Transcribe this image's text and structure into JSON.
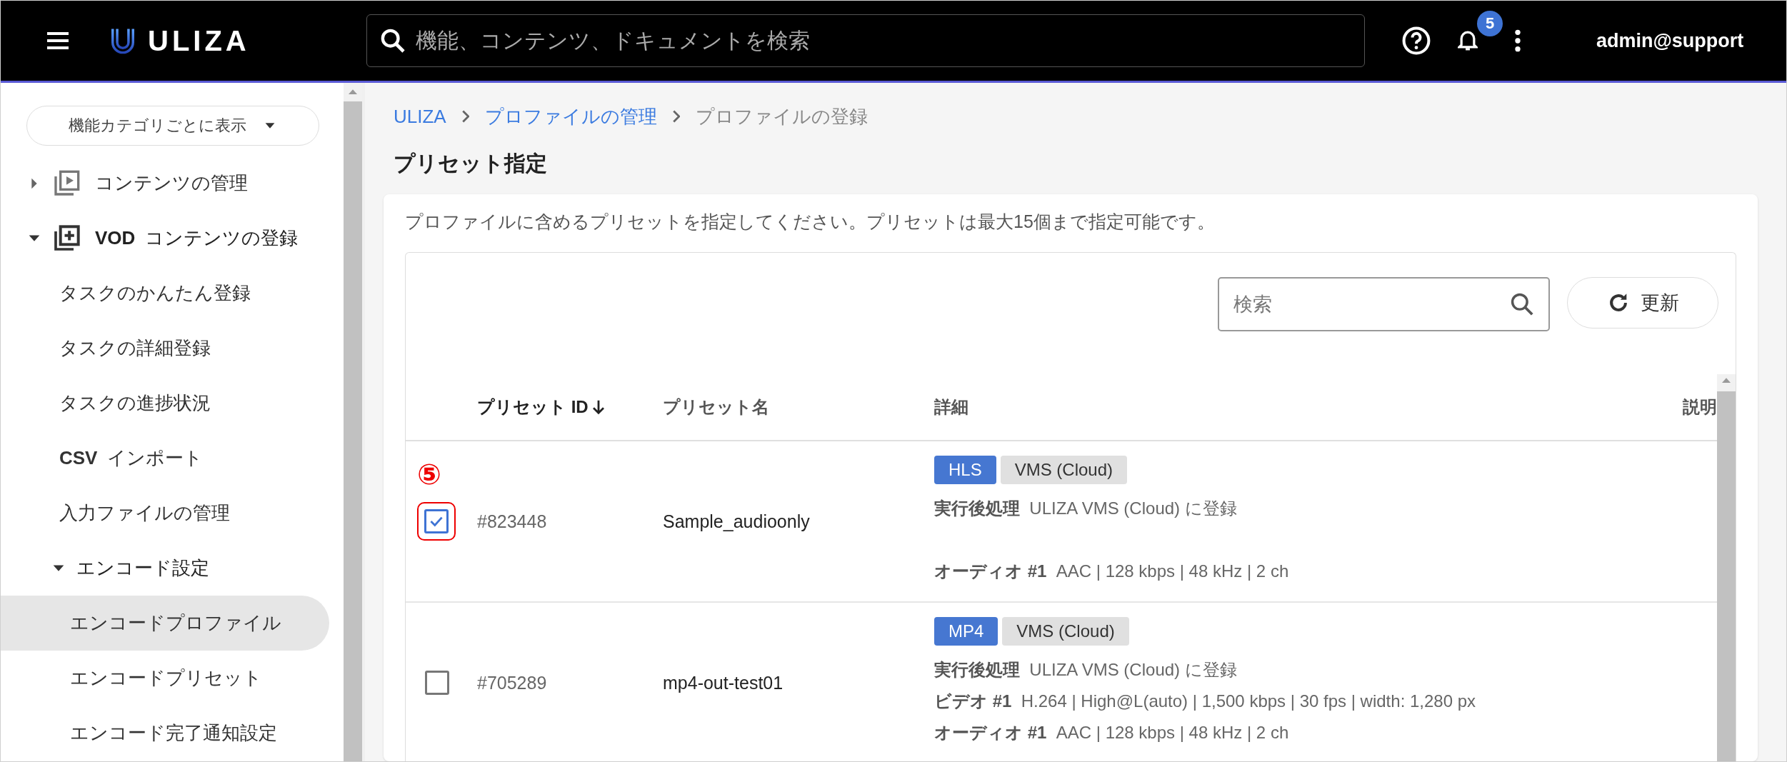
{
  "header": {
    "logo": "ULIZA",
    "search_placeholder": "機能、コンテンツ、ドキュメントを検索",
    "notification_count": "5",
    "user": "admin@support"
  },
  "sidebar": {
    "view_button": "機能カテゴリごとに表示",
    "items": [
      {
        "label": "コンテンツの管理",
        "expanded": false
      },
      {
        "label": "**VOD** コンテンツの登録",
        "expanded": true,
        "children": [
          {
            "label": "タスクのかんたん登録",
            "selected": false
          },
          {
            "label": "タスクの詳細登録",
            "selected": false
          },
          {
            "label": "タスクの進捗状況",
            "selected": false
          },
          {
            "label": "**CSV** インポート",
            "selected": false
          },
          {
            "label": "入力ファイルの管理",
            "selected": false
          },
          {
            "label": "エンコード設定",
            "expanded": true,
            "children": [
              {
                "label": "エンコードプロファイル",
                "selected": true
              },
              {
                "label": "エンコードプリセット",
                "selected": false
              },
              {
                "label": "エンコード完了通知設定",
                "selected": false
              }
            ]
          }
        ]
      }
    ]
  },
  "main": {
    "breadcrumb": [
      {
        "label": "ULIZA",
        "link": true
      },
      {
        "label": "プロファイルの管理",
        "link": true
      },
      {
        "label": "プロファイルの登録",
        "link": false
      }
    ],
    "title": "プリセット指定",
    "description": "プロファイルに含めるプリセットを指定してください。プリセットは最大15個まで指定可能です。",
    "table": {
      "search_placeholder": "検索",
      "refresh_button": "更新",
      "columns": [
        {
          "label": "プリセット ID",
          "sorted": true
        },
        {
          "label": "プリセット名",
          "sorted": false
        },
        {
          "label": "詳細",
          "sorted": false
        },
        {
          "label": "説明",
          "sorted": false
        }
      ],
      "rows": [
        {
          "checked": true,
          "annotation": "⑤",
          "id": "#823448",
          "name": "Sample_audioonly",
          "tags": [
            {
              "label": "HLS",
              "kind": "format"
            },
            {
              "label": "VMS (Cloud)",
              "kind": "destination"
            }
          ],
          "details": [
            {
              "kind": "post",
              "label": "実行後処理",
              "value": "ULIZA VMS (Cloud) に登録"
            },
            {
              "kind": "audio",
              "label": "オーディオ #1",
              "value": "AAC | 128 kbps | 48 kHz | 2 ch"
            }
          ]
        },
        {
          "checked": false,
          "id": "#705289",
          "name": "mp4-out-test01",
          "tags": [
            {
              "label": "MP4",
              "kind": "format"
            },
            {
              "label": "VMS (Cloud)",
              "kind": "destination"
            }
          ],
          "details": [
            {
              "kind": "post",
              "label": "実行後処理",
              "value": "ULIZA VMS (Cloud) に登録"
            },
            {
              "kind": "video",
              "label": "ビデオ #1",
              "value": "H.264 | High@L(auto) | 1,500 kbps | 30 fps | width: 1,280 px"
            },
            {
              "kind": "audio",
              "label": "オーディオ #1",
              "value": "AAC | 128 kbps | 48 kHz | 2 ch"
            }
          ]
        }
      ]
    }
  }
}
